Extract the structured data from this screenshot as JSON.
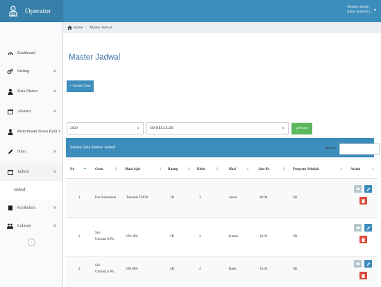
{
  "brand": {
    "title": "Operator"
  },
  "user": {
    "greeting": "Selamat datang,",
    "name": "Alpha Solution (..."
  },
  "breadcrumb": {
    "home": "Home",
    "current": "Master Jadwal"
  },
  "sidebar": {
    "items": [
      {
        "label": "Dashboard",
        "icon": "dashboard-icon"
      },
      {
        "label": "Setting",
        "icon": "cogs-icon"
      },
      {
        "label": "Data Master",
        "icon": "user-icon"
      },
      {
        "label": "Absensi",
        "icon": "calendar-icon"
      },
      {
        "label": "Penerimaan Siswa Baru",
        "icon": "user-icon"
      },
      {
        "label": "Nilai",
        "icon": "pencil-icon"
      },
      {
        "label": "Jadwal",
        "icon": "calendar-icon"
      },
      {
        "label": "Jadwal",
        "icon": ""
      },
      {
        "label": "Kurikulum",
        "icon": "book-icon"
      },
      {
        "label": "Lulusan",
        "icon": "users-icon"
      }
    ]
  },
  "page": {
    "title": "Master Jadwal"
  },
  "toolbar": {
    "add_label": "Tambah Data",
    "proses_label": "Proses"
  },
  "filters": {
    "year": "2020",
    "program": "SD-REGULER"
  },
  "panel": {
    "title": "Semua Data Master Jadwal"
  },
  "search": {
    "label": "Search:"
  },
  "table": {
    "headers": [
      "No",
      "Guru",
      "Mata Ajar",
      "Ruang",
      "Kelas",
      "Hari",
      "Jam Ke",
      "Program Sekolah",
      "Action"
    ],
    "rows": [
      {
        "no": "1",
        "guru1": "Dra.Suhermani",
        "guru2": "",
        "mapel": "Tematik-TMTK",
        "ruang": "2B",
        "kelas": "2",
        "hari": "Senin",
        "jam": "08.00",
        "program": "SD"
      },
      {
        "no": "2",
        "guru1": "Siti",
        "guru2": "Umisari,S.Pd.",
        "mapel": "IPA-IPA",
        "ruang": "2B",
        "kelas": "2",
        "hari": "Kamis",
        "jam": "10.30",
        "program": "SD"
      },
      {
        "no": "3",
        "guru1": "Siti",
        "guru2": "Umisari,S.Pd.",
        "mapel": "IPA-IPA",
        "ruang": "2B",
        "kelas": "2",
        "hari": "Rabu",
        "jam": "10.30",
        "program": "SD"
      }
    ]
  },
  "colors": {
    "primary": "#3c8dbc",
    "brand_dark": "#367fa9",
    "success": "#5cb85c",
    "danger": "#dd4b39"
  }
}
